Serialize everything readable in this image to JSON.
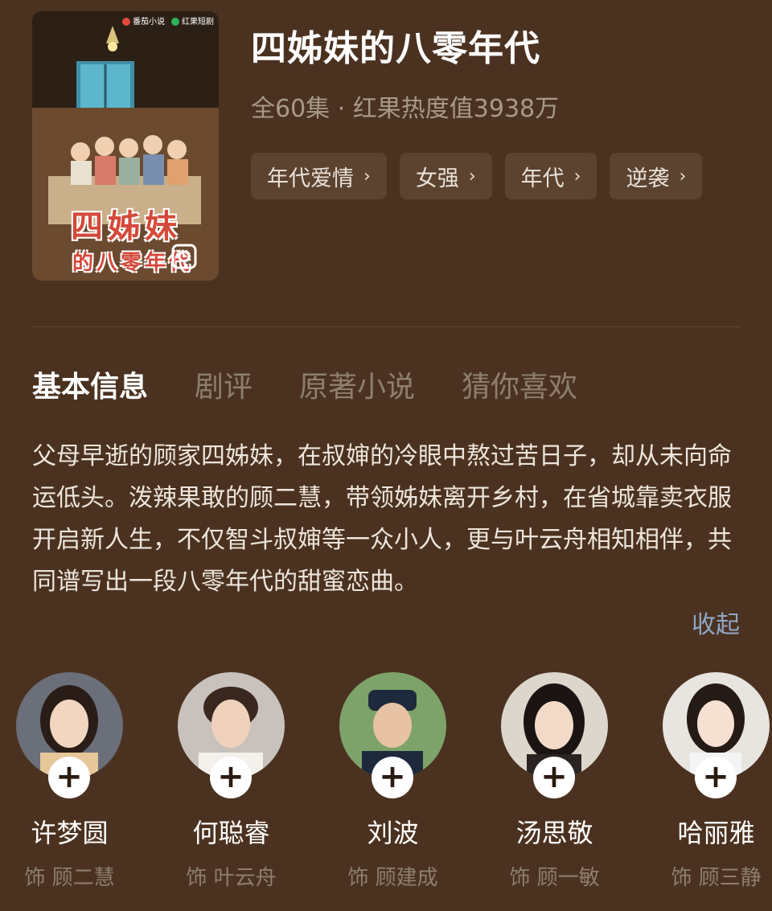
{
  "poster": {
    "title_line1": "四姊妹",
    "title_line2": "的八零年代",
    "logo_1": "番茄小说",
    "logo_2": "红果短剧"
  },
  "show": {
    "title": "四姊妹的八零年代",
    "meta": "全60集 · 红果热度值3938万",
    "tags": [
      {
        "label": "年代爱情",
        "chevron": "›"
      },
      {
        "label": "女强",
        "chevron": "›"
      },
      {
        "label": "年代",
        "chevron": "›"
      },
      {
        "label": "逆袭",
        "chevron": "›"
      }
    ]
  },
  "tabs": [
    {
      "label": "基本信息",
      "active": true
    },
    {
      "label": "剧评",
      "active": false
    },
    {
      "label": "原著小说",
      "active": false
    },
    {
      "label": "猜你喜欢",
      "active": false
    }
  ],
  "description": "父母早逝的顾家四姊妹，在叔婶的冷眼中熬过苦日子，却从未向命运低头。泼辣果敢的顾二慧，带领姊妹离开乡村，在省城靠卖衣服开启新人生，不仅智斗叔婶等一众小人，更与叶云舟相知相伴，共同谱写出一段八零年代的甜蜜恋曲。",
  "collapse_label": "收起",
  "cast": [
    {
      "name": "许梦圆",
      "role": "饰 顾二慧",
      "follow": "+"
    },
    {
      "name": "何聪睿",
      "role": "饰 叶云舟",
      "follow": "+"
    },
    {
      "name": "刘波",
      "role": "饰 顾建成",
      "follow": "+"
    },
    {
      "name": "汤思敬",
      "role": "饰 顾一敏",
      "follow": "+"
    },
    {
      "name": "哈丽雅",
      "role": "饰 顾三静",
      "follow": "+"
    }
  ],
  "colors": {
    "background": "#4b3220",
    "tag_bg": "#5c4330",
    "link": "#8fa7c8",
    "muted": "#8e7e6f"
  }
}
